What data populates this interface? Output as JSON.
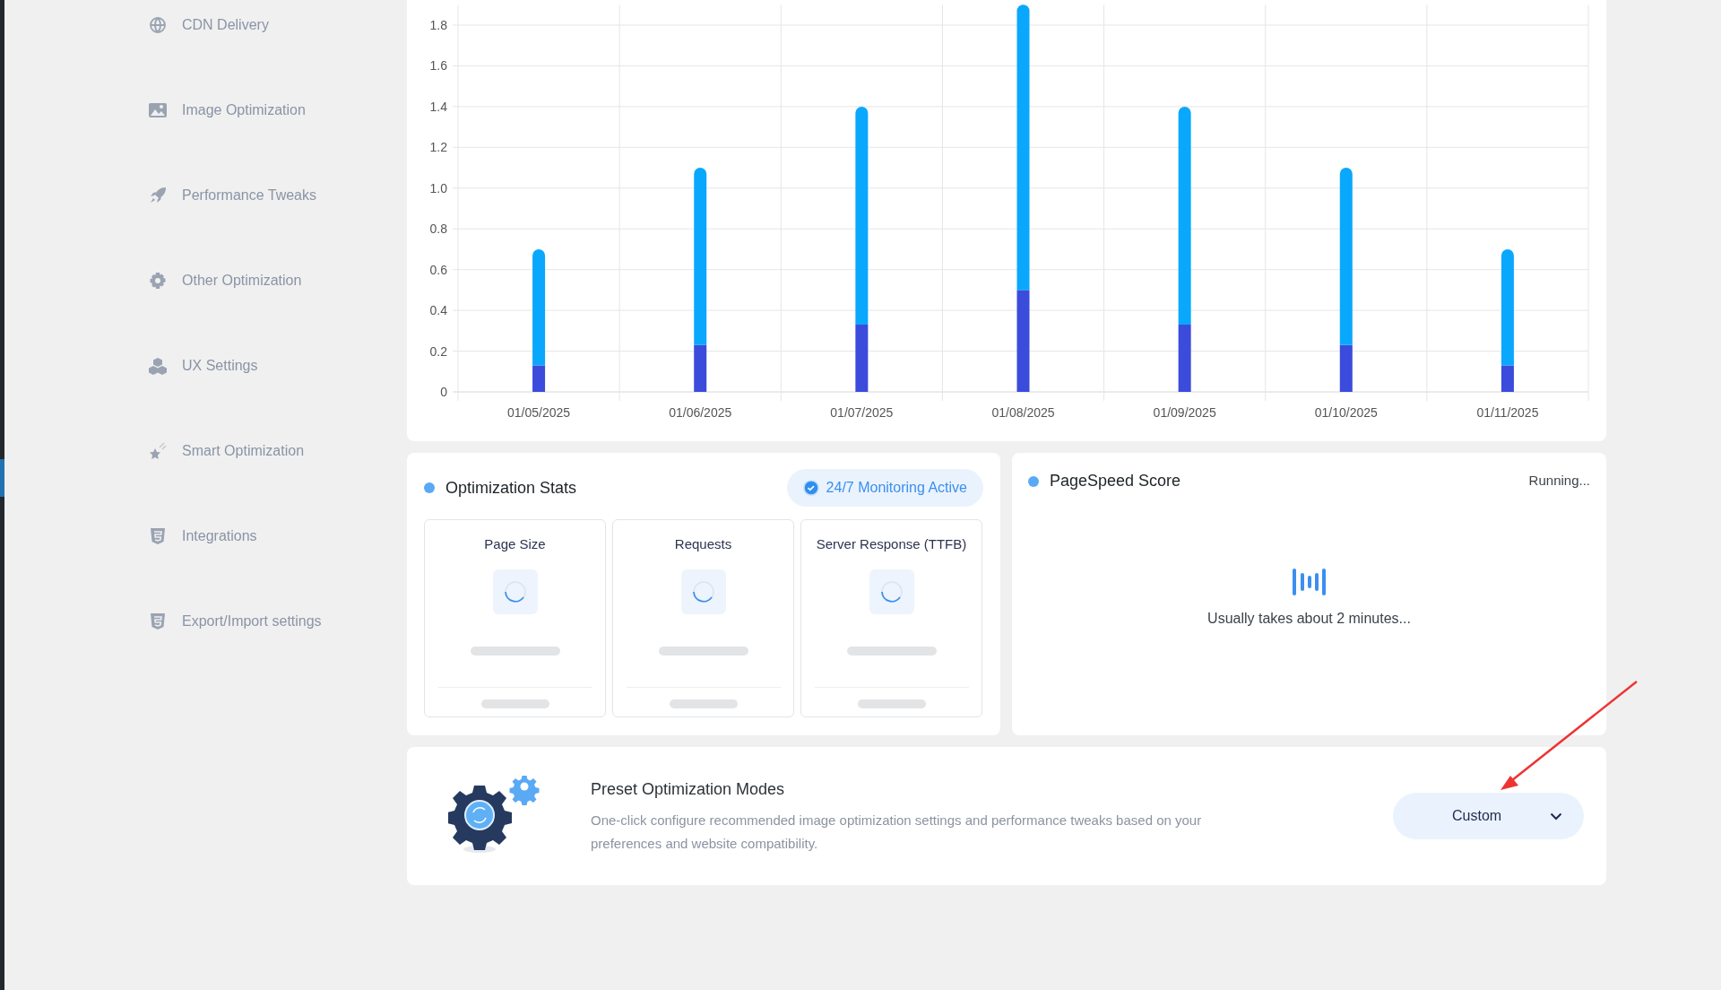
{
  "sidebar": {
    "items": [
      {
        "label": "CDN Delivery"
      },
      {
        "label": "Image Optimization"
      },
      {
        "label": "Performance Tweaks"
      },
      {
        "label": "Other Optimization"
      },
      {
        "label": "UX Settings"
      },
      {
        "label": "Smart Optimization"
      },
      {
        "label": "Integrations"
      },
      {
        "label": "Export/Import settings"
      }
    ]
  },
  "usage_chart": {
    "chart_data": {
      "type": "bar",
      "stacked": true,
      "categories": [
        "01/05/2025",
        "01/06/2025",
        "01/07/2025",
        "01/08/2025",
        "01/09/2025",
        "01/10/2025",
        "01/11/2025"
      ],
      "grid": true,
      "ylim": [
        0,
        1.9
      ],
      "yticks": [
        0,
        0.2,
        0.4,
        0.6,
        0.8,
        {
          "value": 1,
          "label": "1.0"
        },
        1.2,
        1.4,
        1.6,
        1.8
      ],
      "series": [
        {
          "color": "#3b4bdb",
          "values": [
            0.13,
            0.23,
            0.33,
            0.5,
            0.33,
            0.23,
            0.13
          ]
        },
        {
          "color": "#0aa8fd",
          "values": [
            0.57,
            0.87,
            1.07,
            1.4,
            1.07,
            0.87,
            0.57
          ]
        }
      ]
    }
  },
  "optimization_stats": {
    "title": "Optimization Stats",
    "badge": "24/7 Monitoring Active",
    "cards": [
      {
        "title": "Page Size"
      },
      {
        "title": "Requests"
      },
      {
        "title": "Server Response (TTFB)"
      }
    ]
  },
  "pagespeed": {
    "title": "PageSpeed Score",
    "status": "Running...",
    "message": "Usually takes about 2 minutes..."
  },
  "preset_modes": {
    "title": "Preset Optimization Modes",
    "description": "One-click configure recommended image optimization settings and performance tweaks based on your preferences and website compatibility.",
    "select": {
      "value": "Custom"
    }
  }
}
